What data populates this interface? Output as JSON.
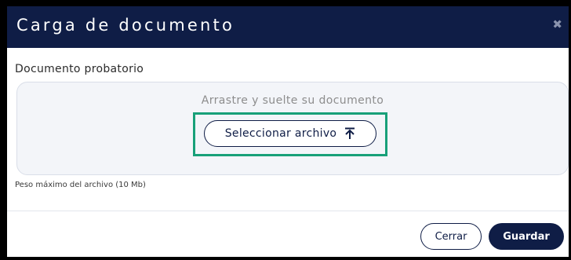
{
  "modal": {
    "title": "Carga de documento",
    "close_icon": "close-x-icon"
  },
  "field": {
    "label": "Documento probatorio",
    "dropzone_hint": "Arrastre y suelte su documento",
    "select_button_label": "Seleccionar archivo",
    "select_button_icon": "upload-icon",
    "size_note": "Peso máximo del archivo (10 Mb)"
  },
  "footer": {
    "close_label": "Cerrar",
    "save_label": "Guardar"
  },
  "colors": {
    "header_bg": "#0f1d46",
    "primary": "#0f1d46",
    "highlight": "#18a079",
    "dropzone_bg": "#f3f5f9"
  }
}
